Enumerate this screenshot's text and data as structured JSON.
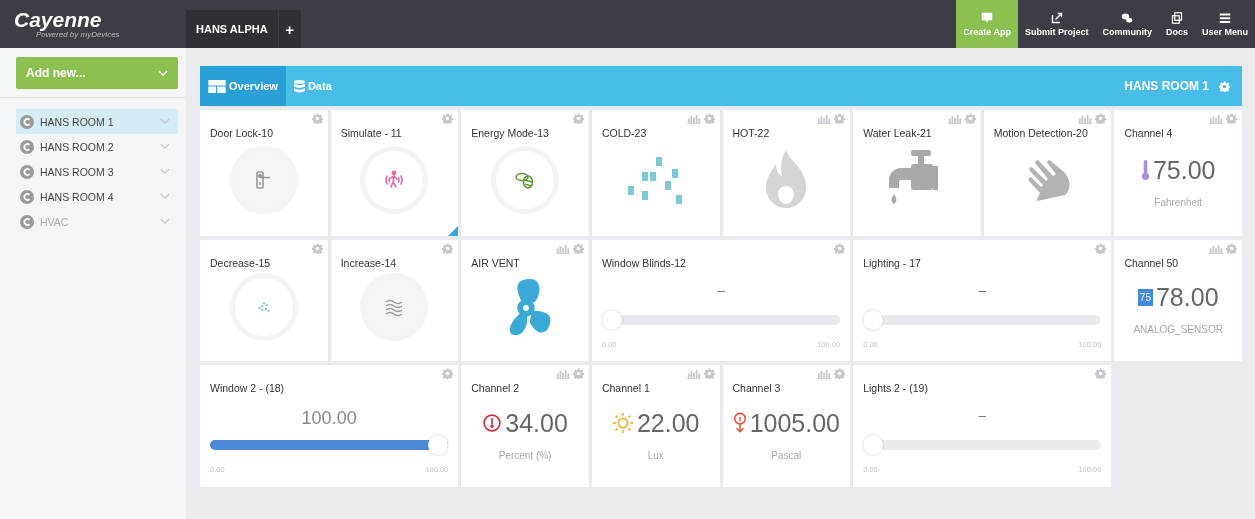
{
  "header": {
    "logo": "Cayenne",
    "tagline": "Powered by myDevices",
    "tabs": [
      {
        "label": "HANS ALPHA",
        "selected": true
      }
    ],
    "add_tab": "+",
    "actions": [
      {
        "label": "Create App",
        "highlighted": true
      },
      {
        "label": "Submit Project",
        "highlighted": false
      },
      {
        "label": "Community",
        "highlighted": false
      },
      {
        "label": "Docs",
        "highlighted": false
      },
      {
        "label": "User Menu",
        "highlighted": false
      }
    ]
  },
  "sidebar": {
    "add_button": "Add new...",
    "items": [
      {
        "label": "HANS ROOM 1",
        "selected": true,
        "disabled": false
      },
      {
        "label": "HANS ROOM 2",
        "selected": false,
        "disabled": false
      },
      {
        "label": "HANS ROOM 3",
        "selected": false,
        "disabled": false
      },
      {
        "label": "HANS ROOM 4",
        "selected": false,
        "disabled": false
      },
      {
        "label": "HVAC",
        "selected": false,
        "disabled": true
      }
    ]
  },
  "project_bar": {
    "tabs": [
      {
        "label": "Overview",
        "selected": true
      },
      {
        "label": "Data",
        "selected": false
      }
    ],
    "title": "HANS ROOM 1"
  },
  "cards": [
    {
      "kind": "button",
      "title": "Door Lock-10",
      "chart": false,
      "active": false
    },
    {
      "kind": "button",
      "title": "Simulate - 11",
      "chart": false,
      "active": true
    },
    {
      "kind": "button",
      "title": "Energy Mode-13",
      "chart": false,
      "active": false
    },
    {
      "kind": "icon",
      "title": "COLD-23",
      "chart": true
    },
    {
      "kind": "icon",
      "title": "HOT-22",
      "chart": true
    },
    {
      "kind": "icon",
      "title": "Water Leak-21",
      "chart": true
    },
    {
      "kind": "icon",
      "title": "Motion Detection-20",
      "chart": true
    },
    {
      "kind": "value",
      "title": "Channel 4",
      "chart": true,
      "value": "75.00",
      "unit": "Fahrenheit"
    },
    {
      "kind": "button",
      "title": "Decrease-15",
      "chart": false,
      "active": false
    },
    {
      "kind": "button",
      "title": "Increase-14",
      "chart": false,
      "active": false
    },
    {
      "kind": "icon",
      "title": "AIR VENT",
      "chart": true
    },
    {
      "kind": "slider",
      "title": "Window Blinds-12",
      "chart": false,
      "value": "–",
      "level": 0,
      "min": "0.00",
      "max": "100.00"
    },
    {
      "kind": "slider",
      "title": "Lighting - 17",
      "chart": false,
      "value": "–",
      "level": 0,
      "min": "0.00",
      "max": "100.00"
    },
    {
      "kind": "value",
      "title": "Channel 50",
      "chart": true,
      "badge": "75",
      "value": "78.00",
      "unit": "ANALOG_SENSOR"
    },
    {
      "kind": "slider",
      "title": "Window 2 - (18)",
      "chart": false,
      "value": "100.00",
      "level": 1,
      "min": "0.00",
      "max": "100.00"
    },
    {
      "kind": "value",
      "title": "Channel 2",
      "chart": true,
      "value": "34.00",
      "unit": "Percent (%)"
    },
    {
      "kind": "value",
      "title": "Channel 1",
      "chart": true,
      "value": "22.00",
      "unit": "Lux"
    },
    {
      "kind": "value",
      "title": "Channel 3",
      "chart": true,
      "value": "1005.00",
      "unit": "Pascal"
    },
    {
      "kind": "slider",
      "title": "Lights 2 - (19)",
      "chart": false,
      "value": "–",
      "level": 0,
      "min": "0.00",
      "max": "100.00"
    }
  ]
}
